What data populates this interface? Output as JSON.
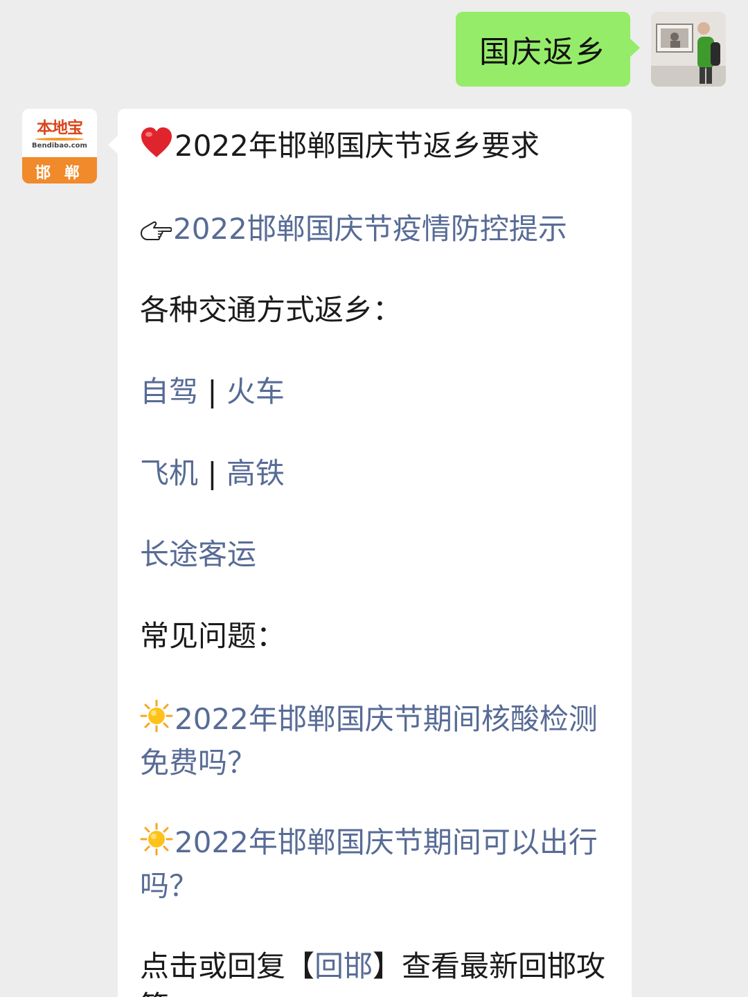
{
  "outgoing": {
    "text": "国庆返乡",
    "avatar": "user-photo"
  },
  "incoming": {
    "avatar": {
      "brand": "本地宝",
      "domain": "Bendibao.com",
      "city": "邯 郸"
    },
    "title": "2022年邯郸国庆节返乡要求",
    "title_icon": "heart-icon",
    "tip_link": "2022邯郸国庆节疫情防控提示",
    "tip_icon": "pointing-hand-icon",
    "transport_heading": "各种交通方式返乡：",
    "transport_links": [
      {
        "left": "自驾",
        "sep": "|",
        "right": "火车"
      },
      {
        "left": "飞机",
        "sep": "|",
        "right": "高铁"
      },
      {
        "single": "长途客运"
      }
    ],
    "faq_heading": "常见问题：",
    "faq_icon": "sun-icon",
    "faq_links": [
      "2022年邯郸国庆节期间核酸检测免费吗？",
      "2022年邯郸国庆节期间可以出行吗？"
    ],
    "footer": {
      "prefix": "点击或回复【",
      "keyword": "回邯",
      "suffix": "】查看最新回邯攻策"
    }
  },
  "colors": {
    "background": "#ededed",
    "bubble_out": "#95ec69",
    "bubble_in": "#ffffff",
    "link": "#576b95",
    "brand_orange": "#f08a2a"
  }
}
